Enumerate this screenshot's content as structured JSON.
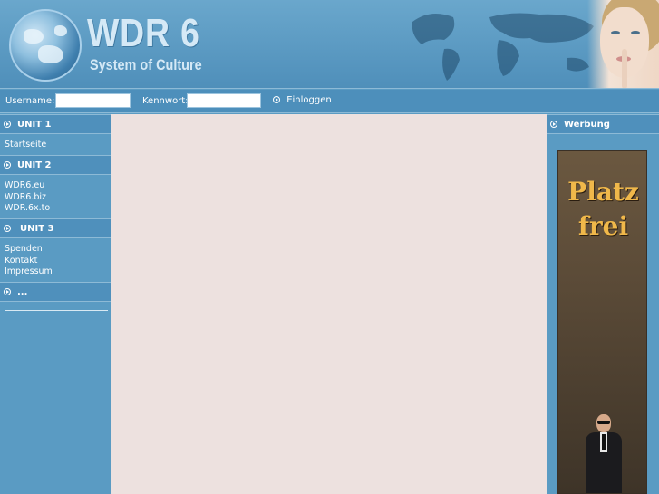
{
  "header": {
    "logo_title": "WDR 6",
    "logo_subtitle": "System of Culture"
  },
  "login": {
    "username_label": "Username:",
    "username_value": "",
    "password_label": "Kennwort:",
    "password_value": "",
    "login_label": "Einloggen"
  },
  "sidebar_left": {
    "units": [
      {
        "title": "UNIT 1",
        "items": [
          "Startseite"
        ]
      },
      {
        "title": "UNIT 2",
        "items": [
          "WDR6.eu",
          "WDR6.biz",
          "WDR.6x.to"
        ]
      },
      {
        "title": "UNIT 3",
        "items": [
          "Spenden",
          "Kontakt",
          "Impressum"
        ]
      },
      {
        "title": "...",
        "items": []
      }
    ]
  },
  "sidebar_right": {
    "title": "Werbung",
    "ad": {
      "line1": "Platz",
      "line2": "frei"
    }
  },
  "colors": {
    "header_blue": "#4f8fba",
    "sidebar_blue": "#5a9bc3",
    "content_bg": "#ede1df",
    "ad_text": "#f0b84a"
  }
}
